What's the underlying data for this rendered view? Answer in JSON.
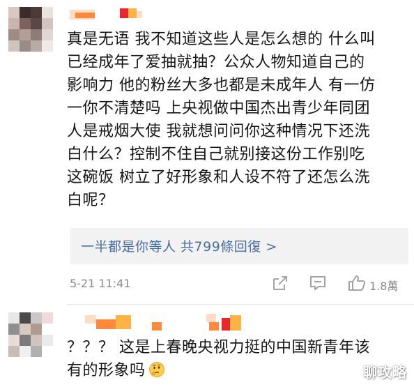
{
  "comment1": {
    "lines": [
      "真是无语 我不知道这些人是怎么想的 什么叫",
      "已经成年了爱抽就抽？公众人物知道自己的",
      "影响力 他的粉丝大多也都是未成年人 有一仿",
      "一你不清楚吗 上央视做中国杰出青少年同团",
      "人是戒烟大使 我就想问问你这种情况下还洗",
      "白什么？控制不住自己就别接这份工作别吃",
      "这碗饭 树立了好形象和人设不符了还怎么洗",
      "白呢？"
    ],
    "reply_link": "一半都是你等人 共799條回復 >",
    "timestamp": "5-21 11:41",
    "like_count": "1.8萬",
    "icons": [
      "share-icon",
      "comment-icon",
      "like-icon"
    ]
  },
  "comment2": {
    "lines": [
      "？？？ 这是上春晚央视力挺的中国新青年该",
      "有的形象吗"
    ],
    "emoji": "thinking-face-icon"
  },
  "watermark": "聊攻略",
  "colors": {
    "link": "#4a6fa5",
    "meta": "#8a8a8a",
    "reply_bg": "#f2f2f2",
    "username_pixelation": [
      "#ff8a3d",
      "#e8262b",
      "#ffb347",
      "#fddcc5"
    ]
  }
}
